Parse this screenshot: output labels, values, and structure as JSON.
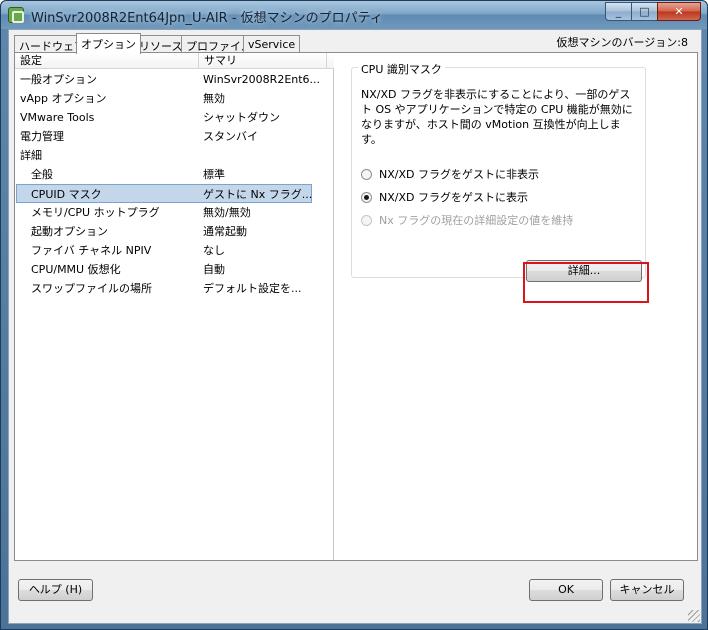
{
  "window": {
    "title": "WinSvr2008R2Ent64Jpn_U-AIR - 仮想マシンのプロパティ",
    "minimize_glyph": "_",
    "maximize_glyph": "□",
    "close_glyph": "✕"
  },
  "tabs": [
    {
      "label": "ハードウェア"
    },
    {
      "label": "オプション"
    },
    {
      "label": "リソース"
    },
    {
      "label": "プロファイル"
    },
    {
      "label": "vService"
    }
  ],
  "version_label": "仮想マシンのバージョン:8",
  "list": {
    "headers": {
      "setting": "設定",
      "summary": "サマリ"
    },
    "rows": [
      {
        "setting": "一般オプション",
        "summary": "WinSvr2008R2Ent6..."
      },
      {
        "setting": "vApp オプション",
        "summary": "無効"
      },
      {
        "setting": "VMware Tools",
        "summary": "シャットダウン"
      },
      {
        "setting": "電力管理",
        "summary": "スタンバイ"
      },
      {
        "setting": "詳細",
        "summary": ""
      },
      {
        "setting": "全般",
        "summary": "標準"
      },
      {
        "setting": "CPUID マスク",
        "summary": "ゲストに Nx フラグ..."
      },
      {
        "setting": "メモリ/CPU ホットプラグ",
        "summary": "無効/無効"
      },
      {
        "setting": "起動オプション",
        "summary": "通常起動"
      },
      {
        "setting": "ファイバ チャネル NPIV",
        "summary": "なし"
      },
      {
        "setting": "CPU/MMU 仮想化",
        "summary": "自動"
      },
      {
        "setting": "スワップファイルの場所",
        "summary": "デフォルト設定を..."
      }
    ]
  },
  "cpuid_group": {
    "legend": "CPU 識別マスク",
    "description": "NX/XD フラグを非表示にすることにより、一部のゲスト OS やアプリケーションで特定の CPU 機能が無効になりますが、ホスト間の vMotion 互換性が向上します。",
    "options": [
      {
        "label": "NX/XD フラグをゲストに非表示"
      },
      {
        "label": "NX/XD フラグをゲストに表示"
      },
      {
        "label": "Nx フラグの現在の詳細設定の値を維持"
      }
    ],
    "detail_button": "詳細..."
  },
  "footer": {
    "help_button": "ヘルプ (H)",
    "ok_button": "OK",
    "cancel_button": "キャンセル"
  },
  "colors": {
    "highlight": "#d9141a",
    "selection": "#c4d7ea"
  }
}
